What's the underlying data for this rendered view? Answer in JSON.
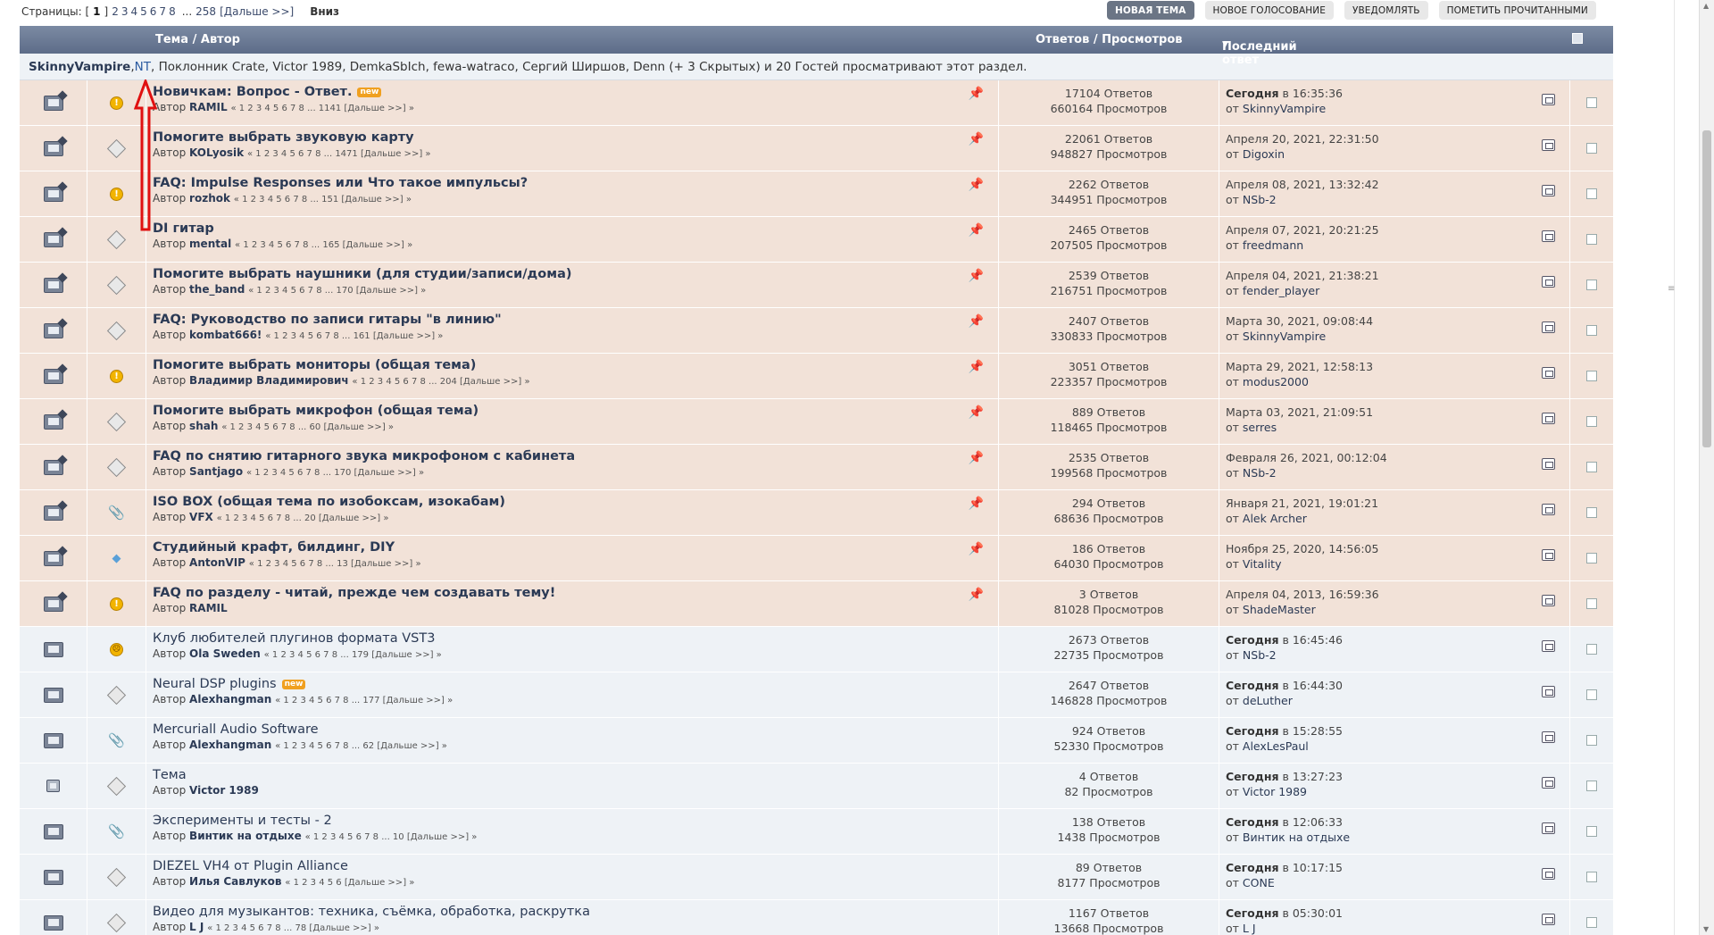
{
  "pagination": {
    "label": "Страницы: [",
    "current": "1",
    "close": "]",
    "pages": [
      "2",
      "3",
      "4",
      "5",
      "6",
      "7",
      "8"
    ],
    "ellipsis": "...",
    "last": "258",
    "next": "[Дальше >>]",
    "down": "Вниз"
  },
  "actions": {
    "new_topic": "НОВАЯ ТЕМА",
    "new_poll": "НОВОЕ ГОЛОСОВАНИЕ",
    "notify": "УВЕДОМЛЯТЬ",
    "mark_read": "ПОМЕТИТЬ ПРОЧИТАННЫМИ"
  },
  "header": {
    "topic": "Тема / Автор",
    "stats": "Ответов / Просмотров",
    "last": "Последний ответ",
    "sort_caret": "▼"
  },
  "viewers": {
    "first": "SkinnyVampire",
    "sep1": ", ",
    "nt": "NT",
    "rest": ", Поклонник Crate, Victor 1989, DemkaSbIch, fewa-watraco, Сергий Ширшов, Denn (+ 3 Скрытых) и 20 Гостей просматривают этот раздел."
  },
  "labels": {
    "author_prefix": "Автор ",
    "by_prefix": "от ",
    "new": "new",
    "today": "Сегодня",
    "at": " в "
  },
  "topics": [
    {
      "sticky": true,
      "status": "warn",
      "title": "Новичкам: Вопрос - Ответ.",
      "new": true,
      "author": "RAMIL",
      "pages": "« 1 2 3 4 5 6 7 8 ... 1141 [Дальше >>] »",
      "replies": "17104 Ответов",
      "views": "660164 Просмотров",
      "today": true,
      "date": "16:35:36",
      "by": "SkinnyVampire"
    },
    {
      "sticky": true,
      "status": "diamond",
      "title": "Помогите выбрать звуковую карту",
      "new": false,
      "author": "KOLyosik",
      "pages": "« 1 2 3 4 5 6 7 8 ... 1471 [Дальше >>] »",
      "replies": "22061 Ответов",
      "views": "948827 Просмотров",
      "today": false,
      "date": "Апреля 20, 2021, 22:31:50",
      "by": "Digoxin"
    },
    {
      "sticky": true,
      "status": "warn",
      "title": "FAQ: Impulse Responses или Что такое импульсы?",
      "new": false,
      "author": "rozhok",
      "pages": "« 1 2 3 4 5 6 7 8 ... 151 [Дальше >>] »",
      "replies": "2262 Ответов",
      "views": "344951 Просмотров",
      "today": false,
      "date": "Апреля 08, 2021, 13:32:42",
      "by": "NSb-2"
    },
    {
      "sticky": true,
      "status": "diamond",
      "title": "DI гитар",
      "new": false,
      "author": "mental",
      "pages": "« 1 2 3 4 5 6 7 8 ... 165 [Дальше >>] »",
      "replies": "2465 Ответов",
      "views": "207505 Просмотров",
      "today": false,
      "date": "Апреля 07, 2021, 20:21:25",
      "by": "freedmann"
    },
    {
      "sticky": true,
      "status": "diamond",
      "title": "Помогите выбрать наушники (для студии/записи/дома)",
      "new": false,
      "author": "the_band",
      "pages": "« 1 2 3 4 5 6 7 8 ... 170 [Дальше >>] »",
      "replies": "2539 Ответов",
      "views": "216751 Просмотров",
      "today": false,
      "date": "Апреля 04, 2021, 21:38:21",
      "by": "fender_player"
    },
    {
      "sticky": true,
      "status": "diamond",
      "title": "FAQ: Руководство по записи гитары \"в линию\"",
      "new": false,
      "author": "kombat666!",
      "pages": "« 1 2 3 4 5 6 7 8 ... 161 [Дальше >>] »",
      "replies": "2407 Ответов",
      "views": "330833 Просмотров",
      "today": false,
      "date": "Марта 30, 2021, 09:08:44",
      "by": "SkinnyVampire"
    },
    {
      "sticky": true,
      "status": "warn",
      "title": "Помогите выбрать мониторы (общая тема)",
      "new": false,
      "author": "Владимир Владимирович",
      "pages": "« 1 2 3 4 5 6 7 8 ... 204 [Дальше >>] »",
      "replies": "3051 Ответов",
      "views": "223357 Просмотров",
      "today": false,
      "date": "Марта 29, 2021, 12:58:13",
      "by": "modus2000"
    },
    {
      "sticky": true,
      "status": "diamond",
      "title": "Помогите выбрать микрофон (общая тема)",
      "new": false,
      "author": "shah",
      "pages": "« 1 2 3 4 5 6 7 8 ... 60 [Дальше >>] »",
      "replies": "889 Ответов",
      "views": "118465 Просмотров",
      "today": false,
      "date": "Марта 03, 2021, 21:09:51",
      "by": "serres"
    },
    {
      "sticky": true,
      "status": "diamond",
      "title": "FAQ по снятию гитарного звука микрофоном с кабинета",
      "new": false,
      "author": "Santjago",
      "pages": "« 1 2 3 4 5 6 7 8 ... 170 [Дальше >>] »",
      "replies": "2535 Ответов",
      "views": "199568 Просмотров",
      "today": false,
      "date": "Февраля 26, 2021, 00:12:04",
      "by": "NSb-2"
    },
    {
      "sticky": true,
      "status": "clip",
      "title": "ISO BOX (общая тема по изобоксам, изокабам)",
      "new": false,
      "author": "VFX",
      "pages": "« 1 2 3 4 5 6 7 8 ... 20 [Дальше >>] »",
      "replies": "294 Ответов",
      "views": "68636 Просмотров",
      "today": false,
      "date": "Января 21, 2021, 19:01:21",
      "by": "Alek Archer"
    },
    {
      "sticky": true,
      "status": "bulb",
      "title": "Студийный крафт, билдинг, DIY",
      "new": false,
      "author": "AntonVIP",
      "pages": "« 1 2 3 4 5 6 7 8 ... 13 [Дальше >>] »",
      "replies": "186 Ответов",
      "views": "64030 Просмотров",
      "today": false,
      "date": "Ноября 25, 2020, 14:56:05",
      "by": "Vitality"
    },
    {
      "sticky": true,
      "status": "warn",
      "title": "FAQ по разделу - читай, прежде чем создавать тему!",
      "new": false,
      "author": "RAMIL",
      "pages": "",
      "replies": "3 Ответов",
      "views": "81028 Просмотров",
      "today": false,
      "date": "Апреля 04, 2013, 16:59:36",
      "by": "ShadeMaster"
    },
    {
      "sticky": false,
      "status": "angry",
      "title": "Клуб любителей плугинов формата VST3",
      "new": false,
      "author": "Ola Sweden",
      "pages": "« 1 2 3 4 5 6 7 8 ... 179 [Дальше >>] »",
      "replies": "2673 Ответов",
      "views": "22735 Просмотров",
      "today": true,
      "date": "16:45:46",
      "by": "NSb-2"
    },
    {
      "sticky": false,
      "status": "diamond",
      "title": "Neural DSP plugins",
      "new": true,
      "author": "Alexhangman",
      "pages": "« 1 2 3 4 5 6 7 8 ... 177 [Дальше >>] »",
      "replies": "2647 Ответов",
      "views": "146828 Просмотров",
      "today": true,
      "date": "16:44:30",
      "by": "deLuther"
    },
    {
      "sticky": false,
      "status": "clip",
      "title": "Mercuriall Audio Software",
      "new": false,
      "author": "Alexhangman",
      "pages": "« 1 2 3 4 5 6 7 8 ... 62 [Дальше >>] »",
      "replies": "924 Ответов",
      "views": "52330 Просмотров",
      "today": true,
      "date": "15:28:55",
      "by": "AlexLesPaul"
    },
    {
      "sticky": false,
      "status": "diamond",
      "title": "Тема",
      "new": false,
      "author": "Victor 1989",
      "pages": "",
      "replies": "4 Ответов",
      "views": "82 Просмотров",
      "today": true,
      "date": "13:27:23",
      "by": "Victor 1989",
      "small": true
    },
    {
      "sticky": false,
      "status": "clip",
      "title": "Эксперименты и тесты - 2",
      "new": false,
      "author": "Винтик на отдыхе",
      "pages": "« 1 2 3 4 5 6 7 8 ... 10 [Дальше >>] »",
      "replies": "138 Ответов",
      "views": "1438 Просмотров",
      "today": true,
      "date": "12:06:33",
      "by": "Винтик на отдыхе"
    },
    {
      "sticky": false,
      "status": "diamond",
      "title": "DIEZEL VH4 от Plugin Alliance",
      "new": false,
      "author": "Илья Савлуков",
      "pages": "« 1 2 3 4 5 6 [Дальше >>] »",
      "replies": "89 Ответов",
      "views": "8177 Просмотров",
      "today": true,
      "date": "10:17:15",
      "by": "CONE"
    },
    {
      "sticky": false,
      "status": "diamond",
      "title": "Видео для музыкантов: техника, съёмка, обработка, раскрутка",
      "new": false,
      "author": "L J",
      "pages": "« 1 2 3 4 5 6 7 8 ... 78 [Дальше >>] »",
      "replies": "1167 Ответов",
      "views": "13668 Просмотров",
      "today": true,
      "date": "05:30:01",
      "by": "L J"
    }
  ]
}
